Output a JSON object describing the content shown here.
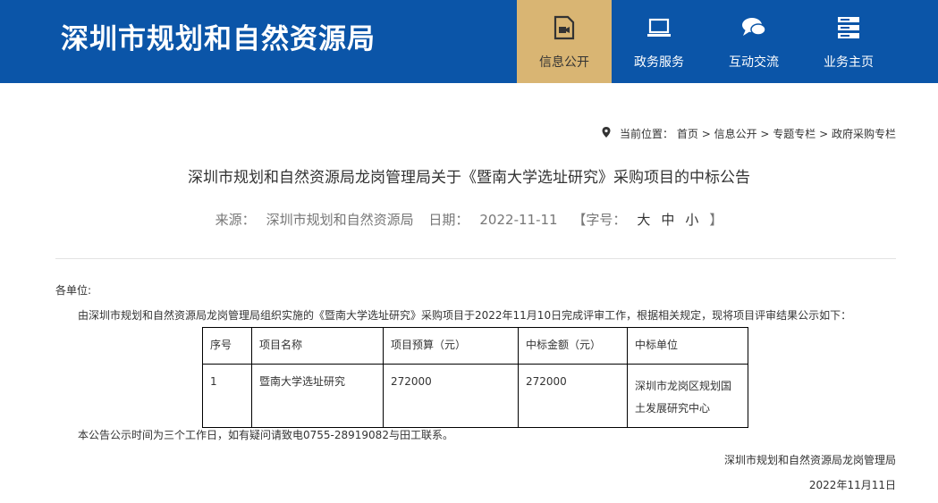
{
  "header": {
    "site_title": "深圳市规划和自然资源局",
    "nav": [
      {
        "label": "信息公开",
        "icon": "video-icon",
        "active": true
      },
      {
        "label": "政务服务",
        "icon": "laptop-icon",
        "active": false
      },
      {
        "label": "互动交流",
        "icon": "chat-icon",
        "active": false
      },
      {
        "label": "业务主页",
        "icon": "server-icon",
        "active": false
      }
    ]
  },
  "breadcrumb": {
    "prefix": "当前位置：",
    "items": [
      "首页",
      "信息公开",
      "专题专栏",
      "政府采购专栏"
    ],
    "separator": " > "
  },
  "article": {
    "title": "深圳市规划和自然资源局龙岗管理局关于《暨南大学选址研究》采购项目的中标公告",
    "source_label": "来源：",
    "source": "深圳市规划和自然资源局",
    "date_label": "日期：",
    "date": "2022-11-11",
    "font_size_label": "【字号：",
    "size_large": "大",
    "size_medium": "中",
    "size_small": "小",
    "font_size_close": "】",
    "salutation": "各单位:",
    "intro": "由深圳市规划和自然资源局龙岗管理局组织实施的《暨南大学选址研究》采购项目于2022年11月10日完成评审工作，根据相关规定，现将项目评审结果公示如下：",
    "table": {
      "headers": [
        "序号",
        "项目名称",
        "项目预算（元）",
        "中标金额（元）",
        "中标单位"
      ],
      "rows": [
        {
          "no": "1",
          "name": "暨南大学选址研究",
          "budget": "272000",
          "amount": "272000",
          "winner_line1": "深圳市龙岗区规划国",
          "winner_line2": "土发展研究中心"
        }
      ]
    },
    "notice": "本公告公示时间为三个工作日，如有疑问请致电0755-28919082与田工联系。",
    "signature": "深圳市规划和自然资源局龙岗管理局",
    "sign_date": "2022年11月11日"
  }
}
